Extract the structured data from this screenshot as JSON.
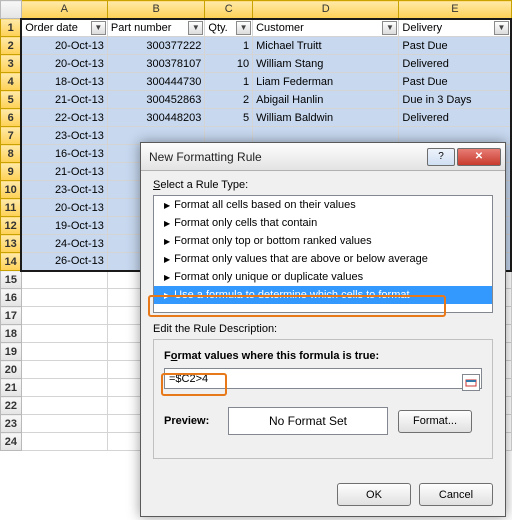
{
  "columns": [
    "A",
    "B",
    "C",
    "D",
    "E"
  ],
  "headers": {
    "A": "Order date",
    "B": "Part number",
    "C": "Qty.",
    "D": "Customer",
    "E": "Delivery"
  },
  "rows": [
    {
      "date": "20-Oct-13",
      "part": "300377222",
      "qty": "1",
      "cust": "Michael Truitt",
      "deliv": "Past Due"
    },
    {
      "date": "20-Oct-13",
      "part": "300378107",
      "qty": "10",
      "cust": "William Stang",
      "deliv": "Delivered"
    },
    {
      "date": "18-Oct-13",
      "part": "300444730",
      "qty": "1",
      "cust": "Liam Federman",
      "deliv": "Past Due"
    },
    {
      "date": "21-Oct-13",
      "part": "300452863",
      "qty": "2",
      "cust": "Abigail Hanlin",
      "deliv": "Due in 3 Days"
    },
    {
      "date": "22-Oct-13",
      "part": "300448203",
      "qty": "5",
      "cust": "William Baldwin",
      "deliv": "Delivered"
    },
    {
      "date": "23-Oct-13",
      "part": "",
      "qty": "",
      "cust": "",
      "deliv": ""
    },
    {
      "date": "16-Oct-13",
      "part": "",
      "qty": "",
      "cust": "",
      "deliv": ""
    },
    {
      "date": "21-Oct-13",
      "part": "",
      "qty": "",
      "cust": "",
      "deliv": ""
    },
    {
      "date": "23-Oct-13",
      "part": "",
      "qty": "",
      "cust": "",
      "deliv": ""
    },
    {
      "date": "20-Oct-13",
      "part": "",
      "qty": "",
      "cust": "",
      "deliv": ""
    },
    {
      "date": "19-Oct-13",
      "part": "",
      "qty": "",
      "cust": "",
      "deliv": ""
    },
    {
      "date": "24-Oct-13",
      "part": "",
      "qty": "",
      "cust": "",
      "deliv": ""
    },
    {
      "date": "26-Oct-13",
      "part": "",
      "qty": "",
      "cust": "",
      "deliv": ""
    }
  ],
  "totalRows": 24,
  "selRows": 13,
  "dialog": {
    "title": "New Formatting Rule",
    "selectLabel": "Select a Rule Type:",
    "ruleTypes": [
      "Format all cells based on their values",
      "Format only cells that contain",
      "Format only top or bottom ranked values",
      "Format only values that are above or below average",
      "Format only unique or duplicate values",
      "Use a formula to determine which cells to format"
    ],
    "selectedRule": 5,
    "editLabel": "Edit the Rule Description:",
    "formatValuesLabel": "Format values where this formula is true:",
    "formula": "=$C2>4",
    "previewLabel": "Preview:",
    "previewText": "No Format Set",
    "formatBtn": "Format...",
    "okBtn": "OK",
    "cancelBtn": "Cancel"
  }
}
